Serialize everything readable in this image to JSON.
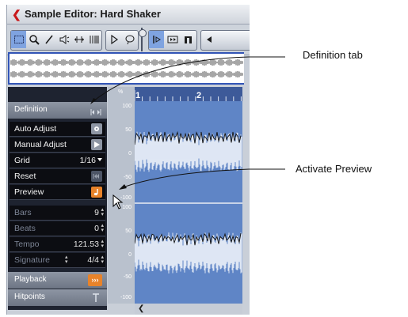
{
  "window": {
    "title": "Sample Editor: Hard Shaker",
    "title_icon": "cubase-logo-icon"
  },
  "toolbar": {
    "tools": [
      "range-select-icon",
      "zoom-icon",
      "pencil-icon",
      "audition-speaker-icon",
      "scrub-icon",
      "time-warp-icon",
      "play-icon",
      "loop-icon",
      "snap-icon",
      "hitpoint-icon",
      "marker-icon",
      "more-icon"
    ]
  },
  "inspector": {
    "definition_tab": {
      "label": "Definition",
      "icon": "collapse-arrows-icon"
    },
    "controls": [
      {
        "label": "Auto Adjust",
        "icon": "gear-icon"
      },
      {
        "label": "Manual Adjust",
        "icon": "play-arrow-icon"
      },
      {
        "label": "Grid",
        "value": "1/16"
      },
      {
        "label": "Reset",
        "icon": "reset-icon"
      },
      {
        "label": "Preview",
        "icon": "music-note-icon"
      }
    ],
    "settings": [
      {
        "label": "Bars",
        "value": "9"
      },
      {
        "label": "Beats",
        "value": "0"
      },
      {
        "label": "Tempo",
        "value": "121.53"
      },
      {
        "label": "Signature",
        "value": "4/4"
      }
    ],
    "playback_tab": {
      "label": "Playback",
      "icon": "chevrons-right-icon"
    },
    "hitpoints_tab": {
      "label": "Hitpoints",
      "icon": "hitpoint-marker-icon"
    }
  },
  "ruler": {
    "marks": [
      "1",
      "2"
    ]
  },
  "scale": {
    "upper": [
      "100",
      "50",
      "0",
      "-50",
      "-100"
    ],
    "lower": [
      "100",
      "50",
      "0",
      "-50",
      "-100"
    ]
  },
  "callouts": {
    "definition_tab": "Definition tab",
    "activate_preview": "Activate Preview"
  },
  "colors": {
    "accent_orange": "#e8832a",
    "waveform_bg": "#5f85c6",
    "ruler_bg": "#3d5a99",
    "inspector_bg": "#1e2330"
  }
}
